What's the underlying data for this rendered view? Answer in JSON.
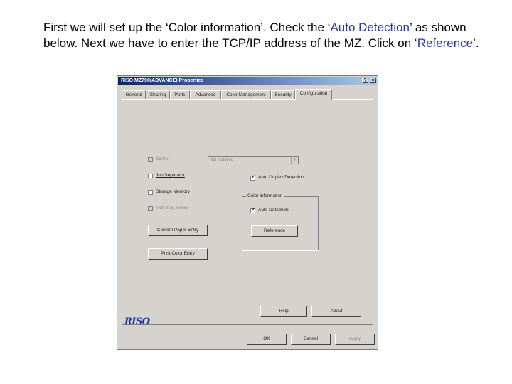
{
  "instruction": {
    "part1": "First we will set up the ‘Color information’. Check the ‘",
    "hl1": "Auto Detection",
    "part2": "’ as shown below. Next we have to enter the TCP/IP address of the MZ. Click on ‘",
    "hl2": "Reference",
    "part3": "’."
  },
  "dialog": {
    "title": "RISO MZ790(ADVANCE) Properties",
    "help_glyph": "?",
    "close_glyph": "×",
    "tabs": [
      "General",
      "Sharing",
      "Ports",
      "Advanced",
      "Color Management",
      "Security",
      "Configuration"
    ],
    "active_tab": "Configuration",
    "sorter": {
      "label": "Sorter",
      "checked": false,
      "disabled": true
    },
    "sorter_select": {
      "value": "Not installed"
    },
    "job_separator": {
      "label": "Job Separator",
      "checked": false,
      "disabled": false
    },
    "storage_memory": {
      "label": "Storage Memory",
      "checked": false,
      "disabled": false
    },
    "multi_tray": {
      "label": "Multi tray feeder",
      "checked": false,
      "disabled": true
    },
    "auto_duplex": {
      "label": "Auto Duplex Detection",
      "checked": true
    },
    "color_group": {
      "title": "Color information"
    },
    "auto_detection": {
      "label": "Auto Detection",
      "checked": true
    },
    "check_mark": "✔",
    "buttons": {
      "custom_paper": "Custom Paper Entry",
      "print_color": "Print Color Entry",
      "reference": "Reference",
      "help": "Help",
      "about": "About",
      "ok": "OK",
      "cancel": "Cancel",
      "apply": "Apply"
    },
    "logo": "RISO"
  }
}
